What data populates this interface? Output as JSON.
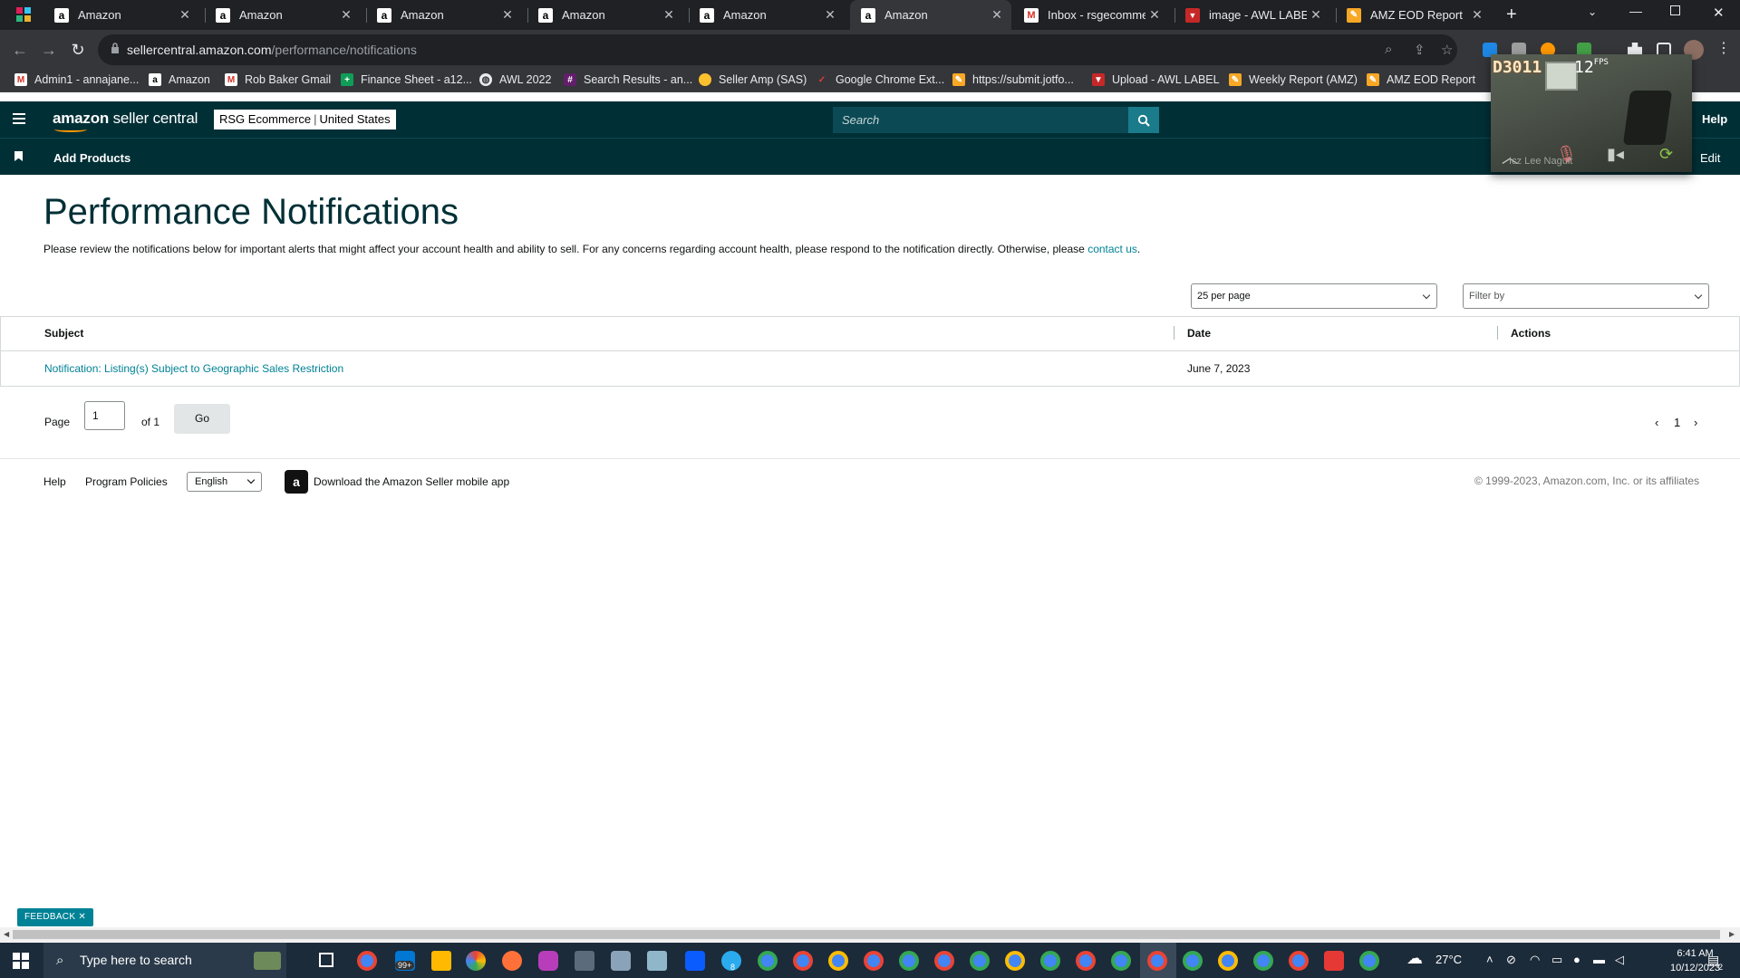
{
  "browser": {
    "tabs": [
      {
        "label": "Amazon",
        "icon": "amazon-favicon",
        "active": false
      },
      {
        "label": "Amazon",
        "icon": "amazon-favicon",
        "active": false
      },
      {
        "label": "Amazon",
        "icon": "amazon-favicon",
        "active": false
      },
      {
        "label": "Amazon",
        "icon": "amazon-favicon",
        "active": false
      },
      {
        "label": "Amazon",
        "icon": "amazon-favicon",
        "active": false
      },
      {
        "label": "Amazon",
        "icon": "amazon-favicon",
        "active": true
      },
      {
        "label": "Inbox - rsgecomme",
        "icon": "gmail-favicon",
        "active": false
      },
      {
        "label": "image - AWL LABEL",
        "icon": "awl-favicon",
        "active": false
      },
      {
        "label": "AMZ EOD Report",
        "icon": "report-favicon",
        "active": false
      }
    ],
    "url_host": "sellercentral.amazon.com",
    "url_path": "/performance/notifications",
    "bookmarks": [
      {
        "label": "Admin1 - annajane...",
        "icon": "gmail-icon"
      },
      {
        "label": "Amazon",
        "icon": "amazon-icon"
      },
      {
        "label": "Rob Baker Gmail",
        "icon": "gmail-icon"
      },
      {
        "label": "Finance Sheet - a12...",
        "icon": "sheets-icon"
      },
      {
        "label": "AWL 2022",
        "icon": "globe-icon"
      },
      {
        "label": "Search Results - an...",
        "icon": "slack-icon"
      },
      {
        "label": "Seller Amp (SAS)",
        "icon": "selleramp-icon"
      },
      {
        "label": "Google Chrome Ext...",
        "icon": "extension-icon"
      },
      {
        "label": "https://submit.jotfo...",
        "icon": "jotform-icon"
      },
      {
        "label": "Upload - AWL LABEL",
        "icon": "awl-icon"
      },
      {
        "label": "Weekly Report (AMZ)",
        "icon": "jotform-icon"
      },
      {
        "label": "AMZ EOD Report",
        "icon": "jotform-icon"
      }
    ]
  },
  "video_overlay": {
    "counter": "D3011",
    "fps_value": "12",
    "fps_unit": "FPS",
    "participant": "Icz Lee Naguit"
  },
  "header": {
    "logo_brand": "amazon",
    "logo_product": "seller central",
    "account_name": "RSG Ecommerce",
    "account_region": "United States",
    "search_placeholder": "Search",
    "help_label": "Help",
    "subnav_add_products": "Add Products",
    "subnav_edit": "Edit"
  },
  "page": {
    "title": "Performance Notifications",
    "intro_text": "Please review the notifications below for important alerts that might affect your account health and ability to sell. For any concerns regarding account health, please respond to the notification directly. Otherwise, please ",
    "intro_link": "contact us",
    "intro_end": ".",
    "per_page": "25 per page",
    "filter_placeholder": "Filter by",
    "table": {
      "columns": [
        "Subject",
        "Date",
        "Actions"
      ],
      "rows": [
        {
          "subject": "Notification: Listing(s) Subject to Geographic Sales Restriction",
          "date": "June 7, 2023",
          "actions": ""
        }
      ]
    },
    "pager": {
      "page_label": "Page",
      "page_value": "1",
      "of_label": "of 1",
      "go_label": "Go",
      "current_page": "1"
    }
  },
  "footer": {
    "help": "Help",
    "program_policies": "Program Policies",
    "language": "English",
    "app_text": "Download the Amazon Seller mobile app",
    "copyright": "© 1999-2023, Amazon.com, Inc. or its affiliates",
    "feedback": "FEEDBACK"
  },
  "taskbar": {
    "search_placeholder": "Type here to search",
    "mail_badge": "99+",
    "telegram_badge": "8",
    "weather": "27°C",
    "time": "6:41 AM",
    "date": "10/12/2023",
    "notification_count": "2"
  },
  "colors": {
    "sc_header": "#002f36",
    "link": "#008296",
    "chrome_dark": "#202124"
  }
}
